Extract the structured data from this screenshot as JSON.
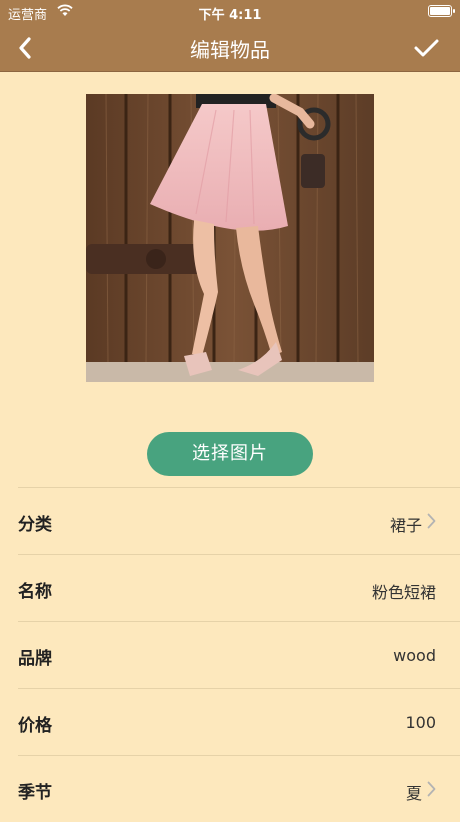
{
  "status": {
    "carrier": "运营商",
    "time": "下午 4:11",
    "battery_level": 1.0
  },
  "nav": {
    "title": "编辑物品",
    "back_icon": "chevron-left-icon",
    "done_icon": "checkmark-icon"
  },
  "photo": {
    "alt": "pink skirt photo"
  },
  "pick_button": "选择图片",
  "fields": [
    {
      "label": "分类",
      "value": "裙子",
      "chevron": true
    },
    {
      "label": "名称",
      "value": "粉色短裙",
      "chevron": false
    },
    {
      "label": "品牌",
      "value": "wood",
      "chevron": false
    },
    {
      "label": "价格",
      "value": "100",
      "chevron": false
    },
    {
      "label": "季节",
      "value": "夏",
      "chevron": true
    }
  ],
  "colors": {
    "nav": "#a87c4e",
    "background": "#fde8bd",
    "button": "#48a37f"
  }
}
